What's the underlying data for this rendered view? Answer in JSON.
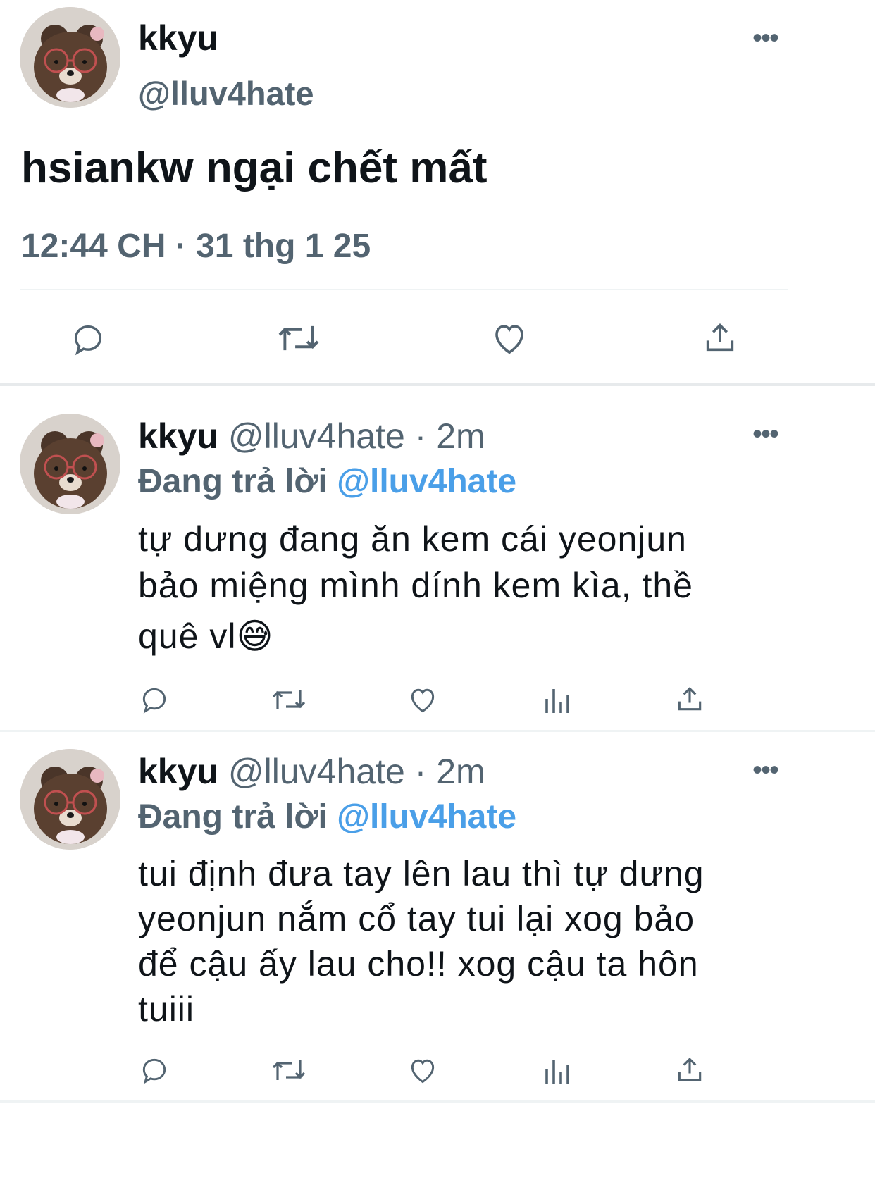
{
  "main_tweet": {
    "display_name": "kkyu",
    "handle": "@lluv4hate",
    "text": "hsiankw ngại chết mất",
    "timestamp": "12:44 CH · 31 thg 1 25"
  },
  "replies": [
    {
      "display_name": "kkyu",
      "handle_time": "@lluv4hate · 2m",
      "replying_prefix": "Đang trả lời",
      "replying_to": "@lluv4hate",
      "text_lines": [
        "tự dưng đang ăn kem cái yeonjun",
        "bảo miệng mình dính kem kìa, thề",
        "quê vl"
      ],
      "emoji": "😅"
    },
    {
      "display_name": "kkyu",
      "handle_time": "@lluv4hate · 2m",
      "replying_prefix": "Đang trả lời",
      "replying_to": "@lluv4hate",
      "text_lines": [
        "tui định đưa tay lên lau thì tự dưng",
        "yeonjun nắm cổ tay tui lại xog bảo",
        "để cậu ấy lau cho!! xog cậu ta hôn",
        "tuiii"
      ]
    }
  ],
  "icons": [
    "reply-icon",
    "retweet-icon",
    "like-icon",
    "views-icon",
    "share-icon",
    "more-icon"
  ],
  "colors": {
    "text": "#0f1419",
    "secondary": "#536471",
    "link": "#4a9fe8",
    "divider": "#eff3f4"
  }
}
